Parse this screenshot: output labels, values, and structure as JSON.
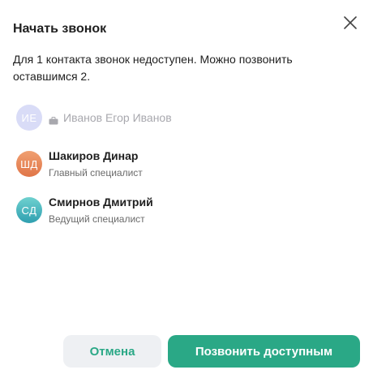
{
  "dialog": {
    "title": "Начать звонок",
    "message": "Для 1 контакта звонок недоступен. Можно позвонить оставшимся 2."
  },
  "contacts": [
    {
      "initials": "ИЕ",
      "name": "Иванов Егор Иванов",
      "role": "",
      "available": false,
      "icon": "briefcase-icon",
      "avatar_color": "#d9dcf7"
    },
    {
      "initials": "ШД",
      "name": "Шакиров Динар",
      "role": "Главный специалист",
      "available": true,
      "avatar_color": "#e8835a"
    },
    {
      "initials": "СД",
      "name": "Смирнов Дмитрий",
      "role": "Ведущий специалист",
      "available": true,
      "avatar_color": "#3fb4b8"
    }
  ],
  "buttons": {
    "cancel_label": "Отмена",
    "call_label": "Позвонить доступным"
  },
  "colors": {
    "accent": "#2aa886",
    "cancel_bg": "#eef0f3",
    "disabled_text": "#a8a8ae"
  }
}
